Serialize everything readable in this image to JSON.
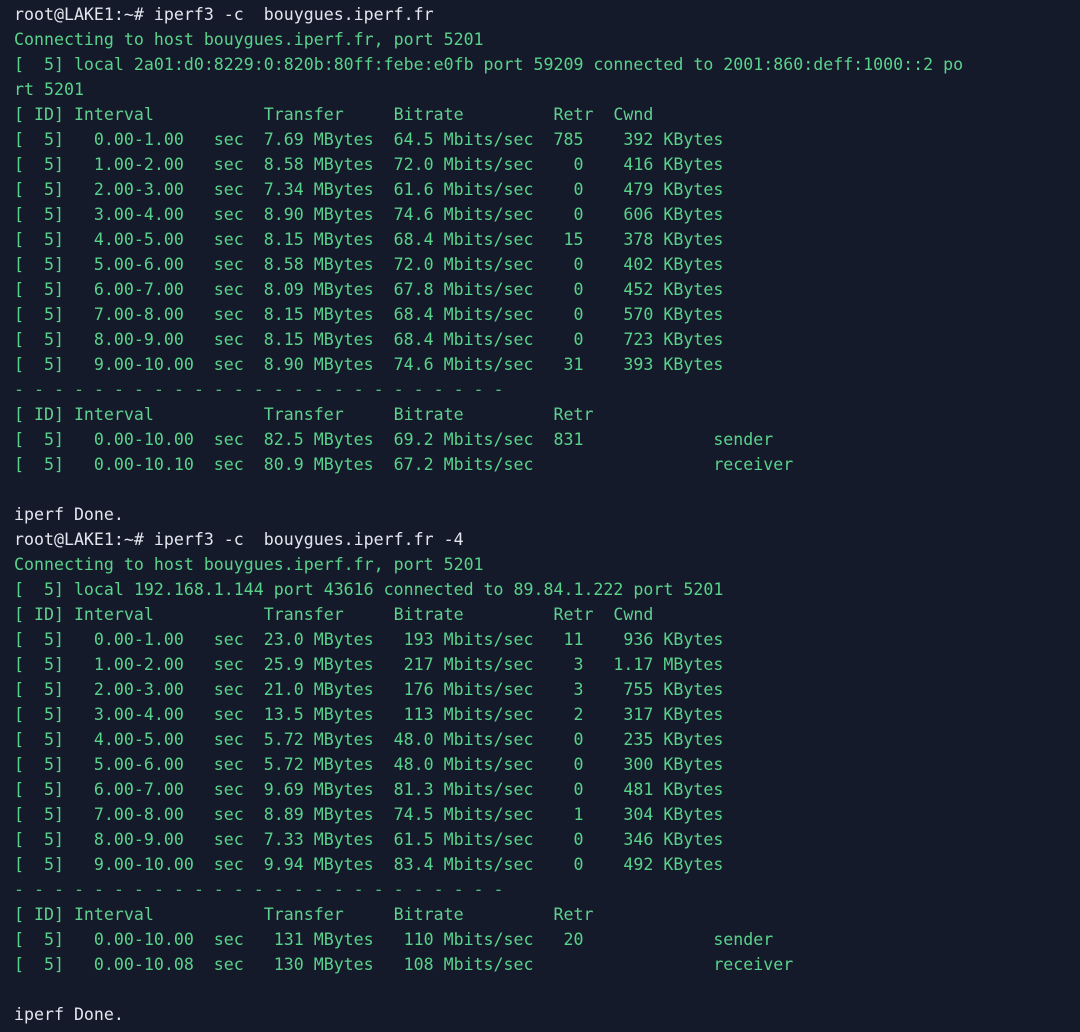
{
  "terminal": {
    "colors": {
      "background": "#151a2a",
      "text_green": "#59d28b",
      "text_light": "#e2e6ee",
      "cursor": "#16c79a"
    },
    "lines": [
      {
        "kind": "prompt",
        "text": "root@LAKE1:~# iperf3 -c  bouygues.iperf.fr"
      },
      {
        "kind": "info",
        "text": "Connecting to host bouygues.iperf.fr, port 5201"
      },
      {
        "kind": "info",
        "text": "[  5] local 2a01:d0:8229:0:820b:80ff:febe:e0fb port 59209 connected to 2001:860:deff:1000::2 po"
      },
      {
        "kind": "info",
        "text": "rt 5201"
      },
      {
        "kind": "header",
        "text": "[ ID] Interval           Transfer     Bitrate         Retr  Cwnd"
      },
      {
        "kind": "row",
        "text": "[  5]   0.00-1.00   sec  7.69 MBytes  64.5 Mbits/sec  785    392 KBytes"
      },
      {
        "kind": "row",
        "text": "[  5]   1.00-2.00   sec  8.58 MBytes  72.0 Mbits/sec    0    416 KBytes"
      },
      {
        "kind": "row",
        "text": "[  5]   2.00-3.00   sec  7.34 MBytes  61.6 Mbits/sec    0    479 KBytes"
      },
      {
        "kind": "row",
        "text": "[  5]   3.00-4.00   sec  8.90 MBytes  74.6 Mbits/sec    0    606 KBytes"
      },
      {
        "kind": "row",
        "text": "[  5]   4.00-5.00   sec  8.15 MBytes  68.4 Mbits/sec   15    378 KBytes"
      },
      {
        "kind": "row",
        "text": "[  5]   5.00-6.00   sec  8.58 MBytes  72.0 Mbits/sec    0    402 KBytes"
      },
      {
        "kind": "row",
        "text": "[  5]   6.00-7.00   sec  8.09 MBytes  67.8 Mbits/sec    0    452 KBytes"
      },
      {
        "kind": "row",
        "text": "[  5]   7.00-8.00   sec  8.15 MBytes  68.4 Mbits/sec    0    570 KBytes"
      },
      {
        "kind": "row",
        "text": "[  5]   8.00-9.00   sec  8.15 MBytes  68.4 Mbits/sec    0    723 KBytes"
      },
      {
        "kind": "row",
        "text": "[  5]   9.00-10.00  sec  8.90 MBytes  74.6 Mbits/sec   31    393 KBytes"
      },
      {
        "kind": "sep",
        "text": "- - - - - - - - - - - - - - - - - - - - - - - - -"
      },
      {
        "kind": "header",
        "text": "[ ID] Interval           Transfer     Bitrate         Retr"
      },
      {
        "kind": "row",
        "text": "[  5]   0.00-10.00  sec  82.5 MBytes  69.2 Mbits/sec  831             sender"
      },
      {
        "kind": "row",
        "text": "[  5]   0.00-10.10  sec  80.9 MBytes  67.2 Mbits/sec                  receiver"
      },
      {
        "kind": "blank",
        "text": ""
      },
      {
        "kind": "done",
        "text": "iperf Done."
      },
      {
        "kind": "prompt",
        "text": "root@LAKE1:~# iperf3 -c  bouygues.iperf.fr -4"
      },
      {
        "kind": "info",
        "text": "Connecting to host bouygues.iperf.fr, port 5201"
      },
      {
        "kind": "info",
        "text": "[  5] local 192.168.1.144 port 43616 connected to 89.84.1.222 port 5201"
      },
      {
        "kind": "header",
        "text": "[ ID] Interval           Transfer     Bitrate         Retr  Cwnd"
      },
      {
        "kind": "row",
        "text": "[  5]   0.00-1.00   sec  23.0 MBytes   193 Mbits/sec   11    936 KBytes"
      },
      {
        "kind": "row",
        "text": "[  5]   1.00-2.00   sec  25.9 MBytes   217 Mbits/sec    3   1.17 MBytes"
      },
      {
        "kind": "row",
        "text": "[  5]   2.00-3.00   sec  21.0 MBytes   176 Mbits/sec    3    755 KBytes"
      },
      {
        "kind": "row",
        "text": "[  5]   3.00-4.00   sec  13.5 MBytes   113 Mbits/sec    2    317 KBytes"
      },
      {
        "kind": "row",
        "text": "[  5]   4.00-5.00   sec  5.72 MBytes  48.0 Mbits/sec    0    235 KBytes"
      },
      {
        "kind": "row",
        "text": "[  5]   5.00-6.00   sec  5.72 MBytes  48.0 Mbits/sec    0    300 KBytes"
      },
      {
        "kind": "row",
        "text": "[  5]   6.00-7.00   sec  9.69 MBytes  81.3 Mbits/sec    0    481 KBytes"
      },
      {
        "kind": "row",
        "text": "[  5]   7.00-8.00   sec  8.89 MBytes  74.5 Mbits/sec    1    304 KBytes"
      },
      {
        "kind": "row",
        "text": "[  5]   8.00-9.00   sec  7.33 MBytes  61.5 Mbits/sec    0    346 KBytes"
      },
      {
        "kind": "row",
        "text": "[  5]   9.00-10.00  sec  9.94 MBytes  83.4 Mbits/sec    0    492 KBytes"
      },
      {
        "kind": "sep",
        "text": "- - - - - - - - - - - - - - - - - - - - - - - - -"
      },
      {
        "kind": "header",
        "text": "[ ID] Interval           Transfer     Bitrate         Retr"
      },
      {
        "kind": "row",
        "text": "[  5]   0.00-10.00  sec   131 MBytes   110 Mbits/sec   20             sender"
      },
      {
        "kind": "row",
        "text": "[  5]   0.00-10.08  sec   130 MBytes   108 Mbits/sec                  receiver"
      },
      {
        "kind": "blank",
        "text": ""
      },
      {
        "kind": "done",
        "text": "iperf Done."
      },
      {
        "kind": "cursor",
        "text": ""
      }
    ]
  }
}
